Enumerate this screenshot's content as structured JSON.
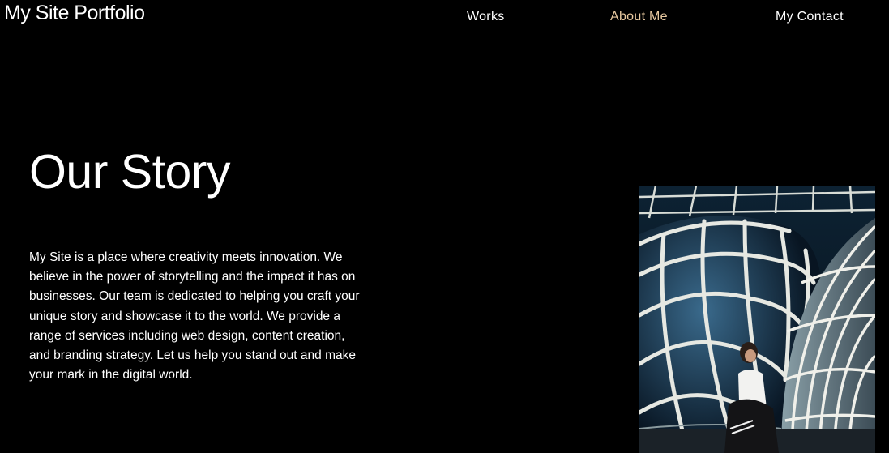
{
  "header": {
    "site_title": "My Site Portfolio",
    "nav": [
      {
        "label": "Works",
        "active": false
      },
      {
        "label": "About Me",
        "active": true
      },
      {
        "label": "My Contact",
        "active": false
      }
    ],
    "active_color": "#e8c9a0"
  },
  "main": {
    "heading": "Our Story",
    "body": "My Site is a place where creativity meets innovation. We believe in the power of storytelling and the impact it has on businesses. Our team is dedicated to helping you craft your unique story and showcase it to the world. We provide a range of services including web design, content creation, and branding strategy. Let us help you stand out and make your mark in the digital world."
  },
  "colors": {
    "background": "#000000",
    "text": "#ffffff"
  }
}
